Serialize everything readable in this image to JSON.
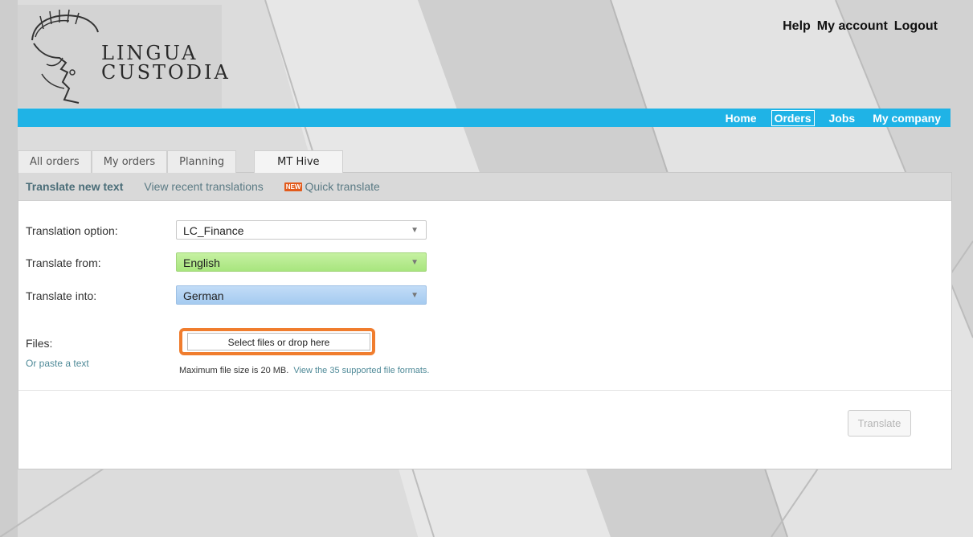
{
  "header": {
    "brand_line1": "LINGUA",
    "brand_line2": "CUSTODIA",
    "top_links": [
      "Help",
      "My account",
      "Logout"
    ]
  },
  "nav": {
    "items": [
      "Home",
      "Orders",
      "Jobs",
      "My company"
    ],
    "active": "Orders"
  },
  "tabs": {
    "items": [
      "All orders",
      "My orders",
      "Planning",
      "MT Hive"
    ],
    "active": "MT Hive"
  },
  "subnav": {
    "items": [
      "Translate new text",
      "View recent translations",
      "Quick translate"
    ],
    "new_badge": "NEW"
  },
  "form": {
    "translation_option_label": "Translation option:",
    "translation_option_value": "LC_Finance",
    "translate_from_label": "Translate from:",
    "translate_from_value": "English",
    "translate_into_label": "Translate into:",
    "translate_into_value": "German",
    "files_label": "Files:",
    "files_button": "Select files or drop here",
    "paste_link": "Or paste a text",
    "max_size_text": "Maximum file size is 20 MB.",
    "formats_link": "View the 35 supported file formats.",
    "translate_button": "Translate"
  },
  "colors": {
    "navbar": "#1fb3e6",
    "highlight": "#f07d2e",
    "from_select": "#b5eb8c",
    "into_select": "#b3d3f4"
  },
  "icons": [
    "helmet-logo-icon",
    "dropdown-arrow-icon"
  ]
}
